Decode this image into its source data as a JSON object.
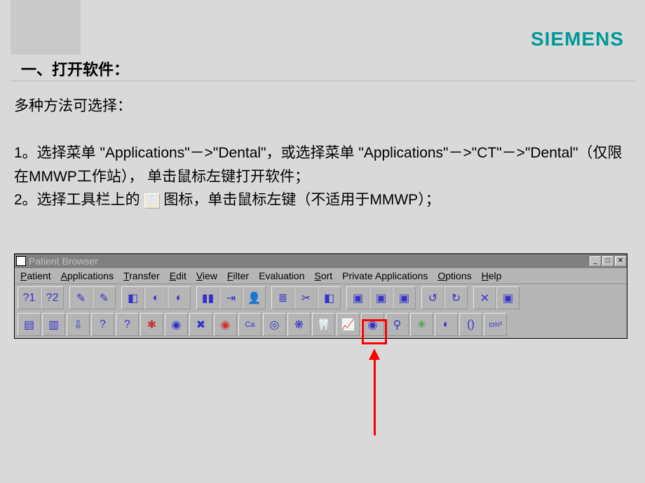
{
  "logo": "SIEMENS",
  "section_title": "一、打开软件：",
  "body": {
    "intro": "多种方法可选择：",
    "line1a": "1。选择菜单 \"Applications\"－>\"Dental\"，或选择菜单 \"Applications\"－>\"CT\"－>\"Dental\"（仅限在MMWP工作站）， 单击鼠标左键打开软件；",
    "line2a": "2。选择工具栏上的",
    "line2b": "图标，单击鼠标左键（不适用于MMWP）；"
  },
  "browser": {
    "title": "Patient Browser",
    "menus": [
      "Patient",
      "Applications",
      "Transfer",
      "Edit",
      "View",
      "Filter",
      "Evaluation",
      "Sort",
      "Private Applications",
      "Options",
      "Help"
    ],
    "window_buttons": [
      "_",
      "□",
      "✕"
    ],
    "toolbar_row1_groups": [
      [
        "?1",
        "?2"
      ],
      [
        "✎",
        "✎"
      ],
      [
        "◧",
        "◐",
        "◐"
      ],
      [
        "▮▮",
        "⇥",
        "👤"
      ],
      [
        "≣",
        "✂",
        "◧"
      ],
      [
        "▣",
        "▣",
        "▣"
      ],
      [
        "↺",
        "↻"
      ],
      [
        "✕",
        "▣"
      ]
    ],
    "toolbar_row2": [
      "▤",
      "▥",
      "⇩",
      "?",
      "?",
      "✱",
      "◉",
      "✖",
      "◉",
      "Ca",
      "◎",
      "❋",
      "🦷",
      "📈",
      "◉",
      "⚲",
      "✳",
      "◐",
      "()",
      "cm³"
    ],
    "dental_index": 12,
    "dental_glyph": "🦷"
  }
}
